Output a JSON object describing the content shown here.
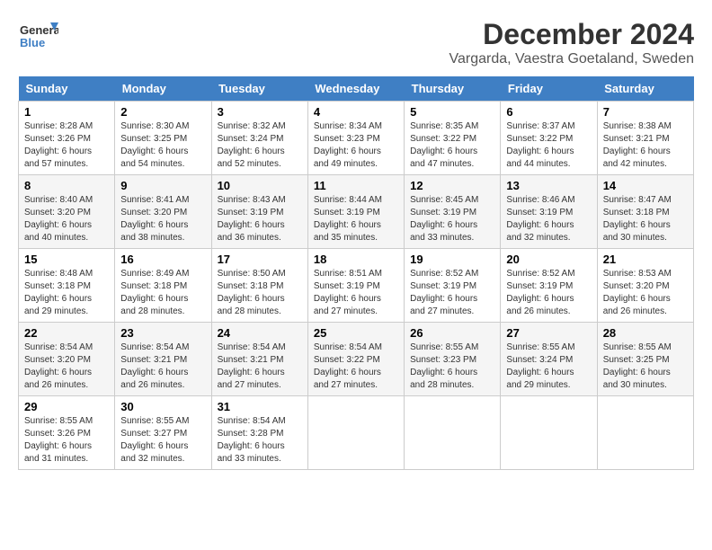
{
  "header": {
    "logo_line1": "General",
    "logo_line2": "Blue",
    "month_title": "December 2024",
    "location": "Vargarda, Vaestra Goetaland, Sweden"
  },
  "days_of_week": [
    "Sunday",
    "Monday",
    "Tuesday",
    "Wednesday",
    "Thursday",
    "Friday",
    "Saturday"
  ],
  "weeks": [
    [
      {
        "day": "1",
        "sunrise": "8:28 AM",
        "sunset": "3:26 PM",
        "daylight": "6 hours and 57 minutes."
      },
      {
        "day": "2",
        "sunrise": "8:30 AM",
        "sunset": "3:25 PM",
        "daylight": "6 hours and 54 minutes."
      },
      {
        "day": "3",
        "sunrise": "8:32 AM",
        "sunset": "3:24 PM",
        "daylight": "6 hours and 52 minutes."
      },
      {
        "day": "4",
        "sunrise": "8:34 AM",
        "sunset": "3:23 PM",
        "daylight": "6 hours and 49 minutes."
      },
      {
        "day": "5",
        "sunrise": "8:35 AM",
        "sunset": "3:22 PM",
        "daylight": "6 hours and 47 minutes."
      },
      {
        "day": "6",
        "sunrise": "8:37 AM",
        "sunset": "3:22 PM",
        "daylight": "6 hours and 44 minutes."
      },
      {
        "day": "7",
        "sunrise": "8:38 AM",
        "sunset": "3:21 PM",
        "daylight": "6 hours and 42 minutes."
      }
    ],
    [
      {
        "day": "8",
        "sunrise": "8:40 AM",
        "sunset": "3:20 PM",
        "daylight": "6 hours and 40 minutes."
      },
      {
        "day": "9",
        "sunrise": "8:41 AM",
        "sunset": "3:20 PM",
        "daylight": "6 hours and 38 minutes."
      },
      {
        "day": "10",
        "sunrise": "8:43 AM",
        "sunset": "3:19 PM",
        "daylight": "6 hours and 36 minutes."
      },
      {
        "day": "11",
        "sunrise": "8:44 AM",
        "sunset": "3:19 PM",
        "daylight": "6 hours and 35 minutes."
      },
      {
        "day": "12",
        "sunrise": "8:45 AM",
        "sunset": "3:19 PM",
        "daylight": "6 hours and 33 minutes."
      },
      {
        "day": "13",
        "sunrise": "8:46 AM",
        "sunset": "3:19 PM",
        "daylight": "6 hours and 32 minutes."
      },
      {
        "day": "14",
        "sunrise": "8:47 AM",
        "sunset": "3:18 PM",
        "daylight": "6 hours and 30 minutes."
      }
    ],
    [
      {
        "day": "15",
        "sunrise": "8:48 AM",
        "sunset": "3:18 PM",
        "daylight": "6 hours and 29 minutes."
      },
      {
        "day": "16",
        "sunrise": "8:49 AM",
        "sunset": "3:18 PM",
        "daylight": "6 hours and 28 minutes."
      },
      {
        "day": "17",
        "sunrise": "8:50 AM",
        "sunset": "3:18 PM",
        "daylight": "6 hours and 28 minutes."
      },
      {
        "day": "18",
        "sunrise": "8:51 AM",
        "sunset": "3:19 PM",
        "daylight": "6 hours and 27 minutes."
      },
      {
        "day": "19",
        "sunrise": "8:52 AM",
        "sunset": "3:19 PM",
        "daylight": "6 hours and 27 minutes."
      },
      {
        "day": "20",
        "sunrise": "8:52 AM",
        "sunset": "3:19 PM",
        "daylight": "6 hours and 26 minutes."
      },
      {
        "day": "21",
        "sunrise": "8:53 AM",
        "sunset": "3:20 PM",
        "daylight": "6 hours and 26 minutes."
      }
    ],
    [
      {
        "day": "22",
        "sunrise": "8:54 AM",
        "sunset": "3:20 PM",
        "daylight": "6 hours and 26 minutes."
      },
      {
        "day": "23",
        "sunrise": "8:54 AM",
        "sunset": "3:21 PM",
        "daylight": "6 hours and 26 minutes."
      },
      {
        "day": "24",
        "sunrise": "8:54 AM",
        "sunset": "3:21 PM",
        "daylight": "6 hours and 27 minutes."
      },
      {
        "day": "25",
        "sunrise": "8:54 AM",
        "sunset": "3:22 PM",
        "daylight": "6 hours and 27 minutes."
      },
      {
        "day": "26",
        "sunrise": "8:55 AM",
        "sunset": "3:23 PM",
        "daylight": "6 hours and 28 minutes."
      },
      {
        "day": "27",
        "sunrise": "8:55 AM",
        "sunset": "3:24 PM",
        "daylight": "6 hours and 29 minutes."
      },
      {
        "day": "28",
        "sunrise": "8:55 AM",
        "sunset": "3:25 PM",
        "daylight": "6 hours and 30 minutes."
      }
    ],
    [
      {
        "day": "29",
        "sunrise": "8:55 AM",
        "sunset": "3:26 PM",
        "daylight": "6 hours and 31 minutes."
      },
      {
        "day": "30",
        "sunrise": "8:55 AM",
        "sunset": "3:27 PM",
        "daylight": "6 hours and 32 minutes."
      },
      {
        "day": "31",
        "sunrise": "8:54 AM",
        "sunset": "3:28 PM",
        "daylight": "6 hours and 33 minutes."
      },
      null,
      null,
      null,
      null
    ]
  ]
}
